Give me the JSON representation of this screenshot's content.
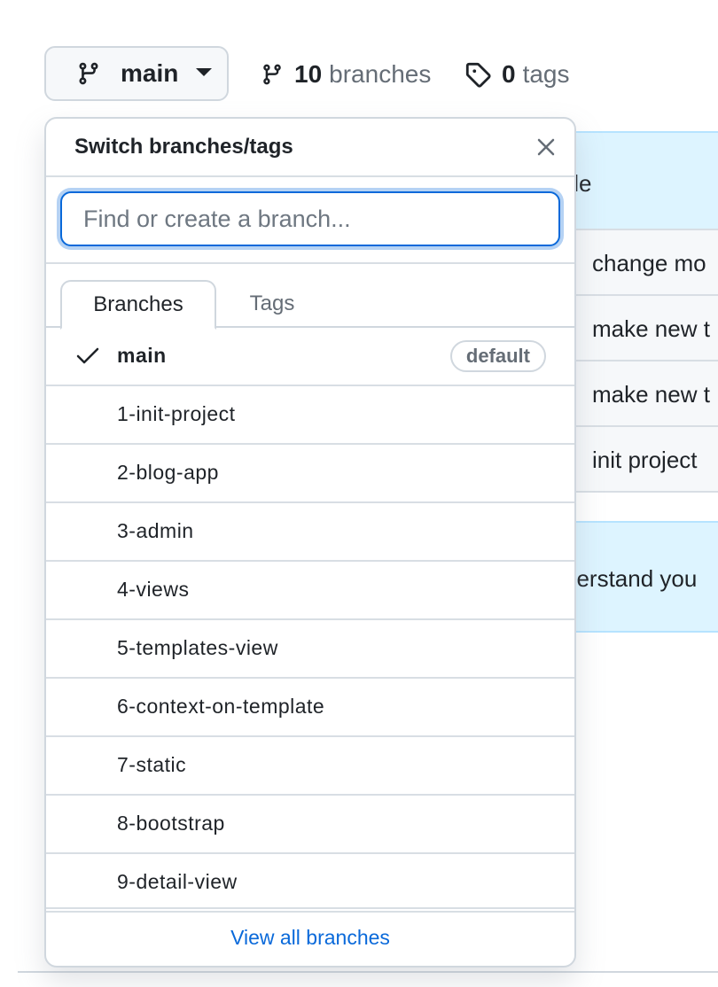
{
  "branch_button": {
    "label": "main"
  },
  "branches_link": {
    "count": "10",
    "label": "branches"
  },
  "tags_link": {
    "count": "0",
    "label": "tags"
  },
  "background": {
    "header_text": "tle",
    "rows": [
      "change mo",
      "make new t",
      "make new t",
      "init project"
    ],
    "box_text": "derstand you"
  },
  "dropdown": {
    "title": "Switch branches/tags",
    "filter_placeholder": "Find or create a branch...",
    "tabs": [
      {
        "label": "Branches"
      },
      {
        "label": "Tags"
      }
    ],
    "branches": [
      {
        "name": "main",
        "badge": "default"
      },
      {
        "name": "1-init-project"
      },
      {
        "name": "2-blog-app"
      },
      {
        "name": "3-admin"
      },
      {
        "name": "4-views"
      },
      {
        "name": "5-templates-view"
      },
      {
        "name": "6-context-on-template"
      },
      {
        "name": "7-static"
      },
      {
        "name": "8-bootstrap"
      },
      {
        "name": "9-detail-view"
      }
    ],
    "footer_link": "View all branches"
  },
  "colors": {
    "accent": "#0969da",
    "text": "#1f2328",
    "muted": "#656d76",
    "border": "#d0d7de",
    "highlight_bg": "#ddf4ff"
  },
  "icons": {
    "branch": "git-branch-icon",
    "caret": "caret-down-icon",
    "tag": "tag-icon",
    "close": "close-icon",
    "check": "check-icon"
  }
}
